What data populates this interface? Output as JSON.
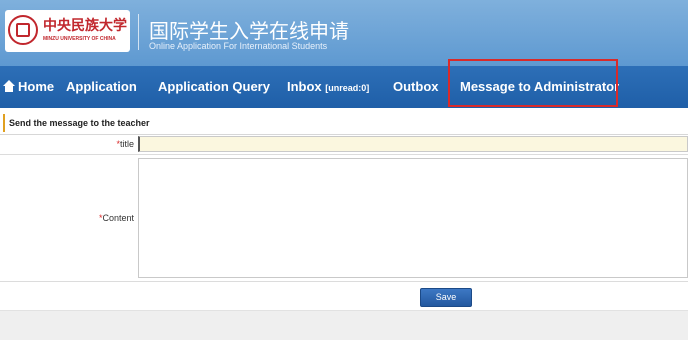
{
  "header": {
    "logo_cn": "中央民族大学",
    "logo_en": "MINZU UNIVERSITY OF CHINA",
    "title_cn": "国际学生入学在线申请",
    "title_en": "Online Application For International Students"
  },
  "nav": {
    "home": "Home",
    "application": "Application",
    "application_query": "Application Query",
    "inbox": "Inbox",
    "inbox_unread": "[unread:0]",
    "outbox": "Outbox",
    "message_admin": "Message to Administrator"
  },
  "form": {
    "section_title": "Send the message to the teacher",
    "required_mark": "*",
    "title_label": "title",
    "title_value": "",
    "content_label": "Content",
    "content_value": "",
    "save_label": "Save"
  },
  "colors": {
    "header_bg": "#6fa6d8",
    "nav_bg": "#2566ae",
    "highlight_border": "#d92a2a",
    "title_input_bg": "#fbf7df",
    "required_mark": "#d92a2a"
  },
  "icons": {
    "home": "home-icon",
    "logo": "university-seal-icon"
  }
}
